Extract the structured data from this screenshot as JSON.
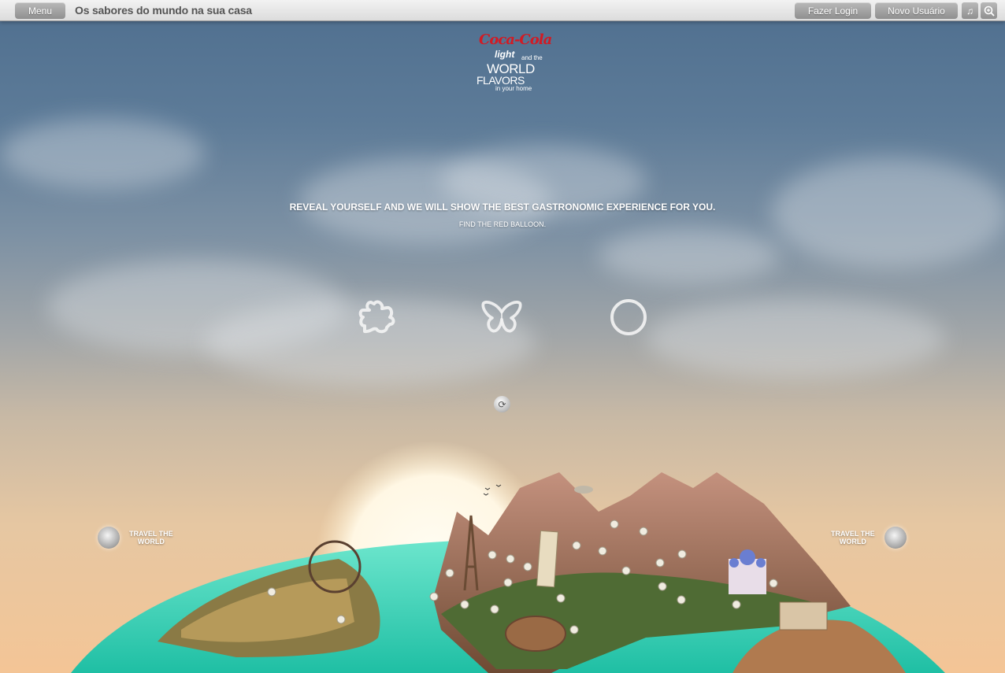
{
  "topbar": {
    "menu_label": "Menu",
    "site_title": "Os sabores do mundo na sua casa",
    "login_label": "Fazer Login",
    "new_user_label": "Novo Usuário",
    "music_icon": "music-note-icon",
    "zoom_icon": "zoom-icon"
  },
  "logo": {
    "brand": "Coca-Cola",
    "light": "light",
    "and_the": "and the",
    "world": "WORLD",
    "flavors": "FLAVORS",
    "in_your_home": "in your home"
  },
  "main": {
    "headline": "REVEAL YOURSELF AND WE WILL SHOW THE BEST GASTRONOMIC EXPERIENCE FOR YOU.",
    "subline": "FIND THE RED BALLOON.",
    "shapes": [
      "puzzle-piece-icon",
      "butterfly-icon",
      "circle-icon"
    ],
    "refresh_icon": "refresh-icon"
  },
  "travel": {
    "left_label_1": "TRAVEL THE",
    "left_label_2": "WORLD",
    "right_label_1": "TRAVEL THE",
    "right_label_2": "WORLD"
  },
  "colors": {
    "sky_top": "#4f6f8f",
    "sky_bottom": "#f4c596",
    "sea": "#34d3b6",
    "brand_red": "#d11b24"
  }
}
